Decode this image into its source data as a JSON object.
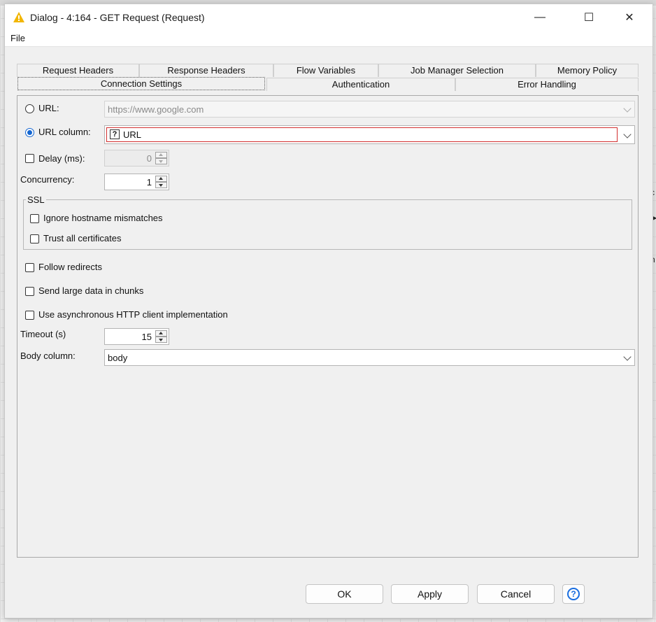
{
  "window": {
    "title": "Dialog - 4:164 - GET Request (Request)",
    "minimize_glyph": "—",
    "maximize_glyph": "☐",
    "close_glyph": "✕",
    "warning_icon": "warning-triangle-icon",
    "accent_color": "#f2b600"
  },
  "menu": {
    "file": "File"
  },
  "tabs": {
    "row_back": [
      "Request Headers",
      "Response Headers",
      "Flow Variables",
      "Job Manager Selection",
      "Memory Policy"
    ],
    "row_front": [
      "Connection Settings",
      "Authentication",
      "Error Handling"
    ],
    "selected": "Connection Settings"
  },
  "form": {
    "url_label": "URL:",
    "url_value": "https://www.google.com",
    "url_column_label": "URL column:",
    "url_column_value": "URL",
    "url_column_icon": "?",
    "delay_label": "Delay (ms):",
    "delay_value": "0",
    "concurrency_label": "Concurrency:",
    "concurrency_value": "1",
    "ssl_legend": "SSL",
    "ignore_hostname": "Ignore hostname mismatches",
    "trust_certs": "Trust all certificates",
    "follow_redirects": "Follow redirects",
    "send_chunks": "Send large data in chunks",
    "async_client": "Use asynchronous HTTP client implementation",
    "timeout_label": "Timeout (s)",
    "timeout_value": "15",
    "body_column_label": "Body column:",
    "body_column_value": "body",
    "selected_radio": "URL column",
    "radio_color": "#1466d1",
    "error_border_color": "#d22f2f"
  },
  "buttons": {
    "ok": "OK",
    "apply": "Apply",
    "cancel": "Cancel",
    "help": "?"
  }
}
